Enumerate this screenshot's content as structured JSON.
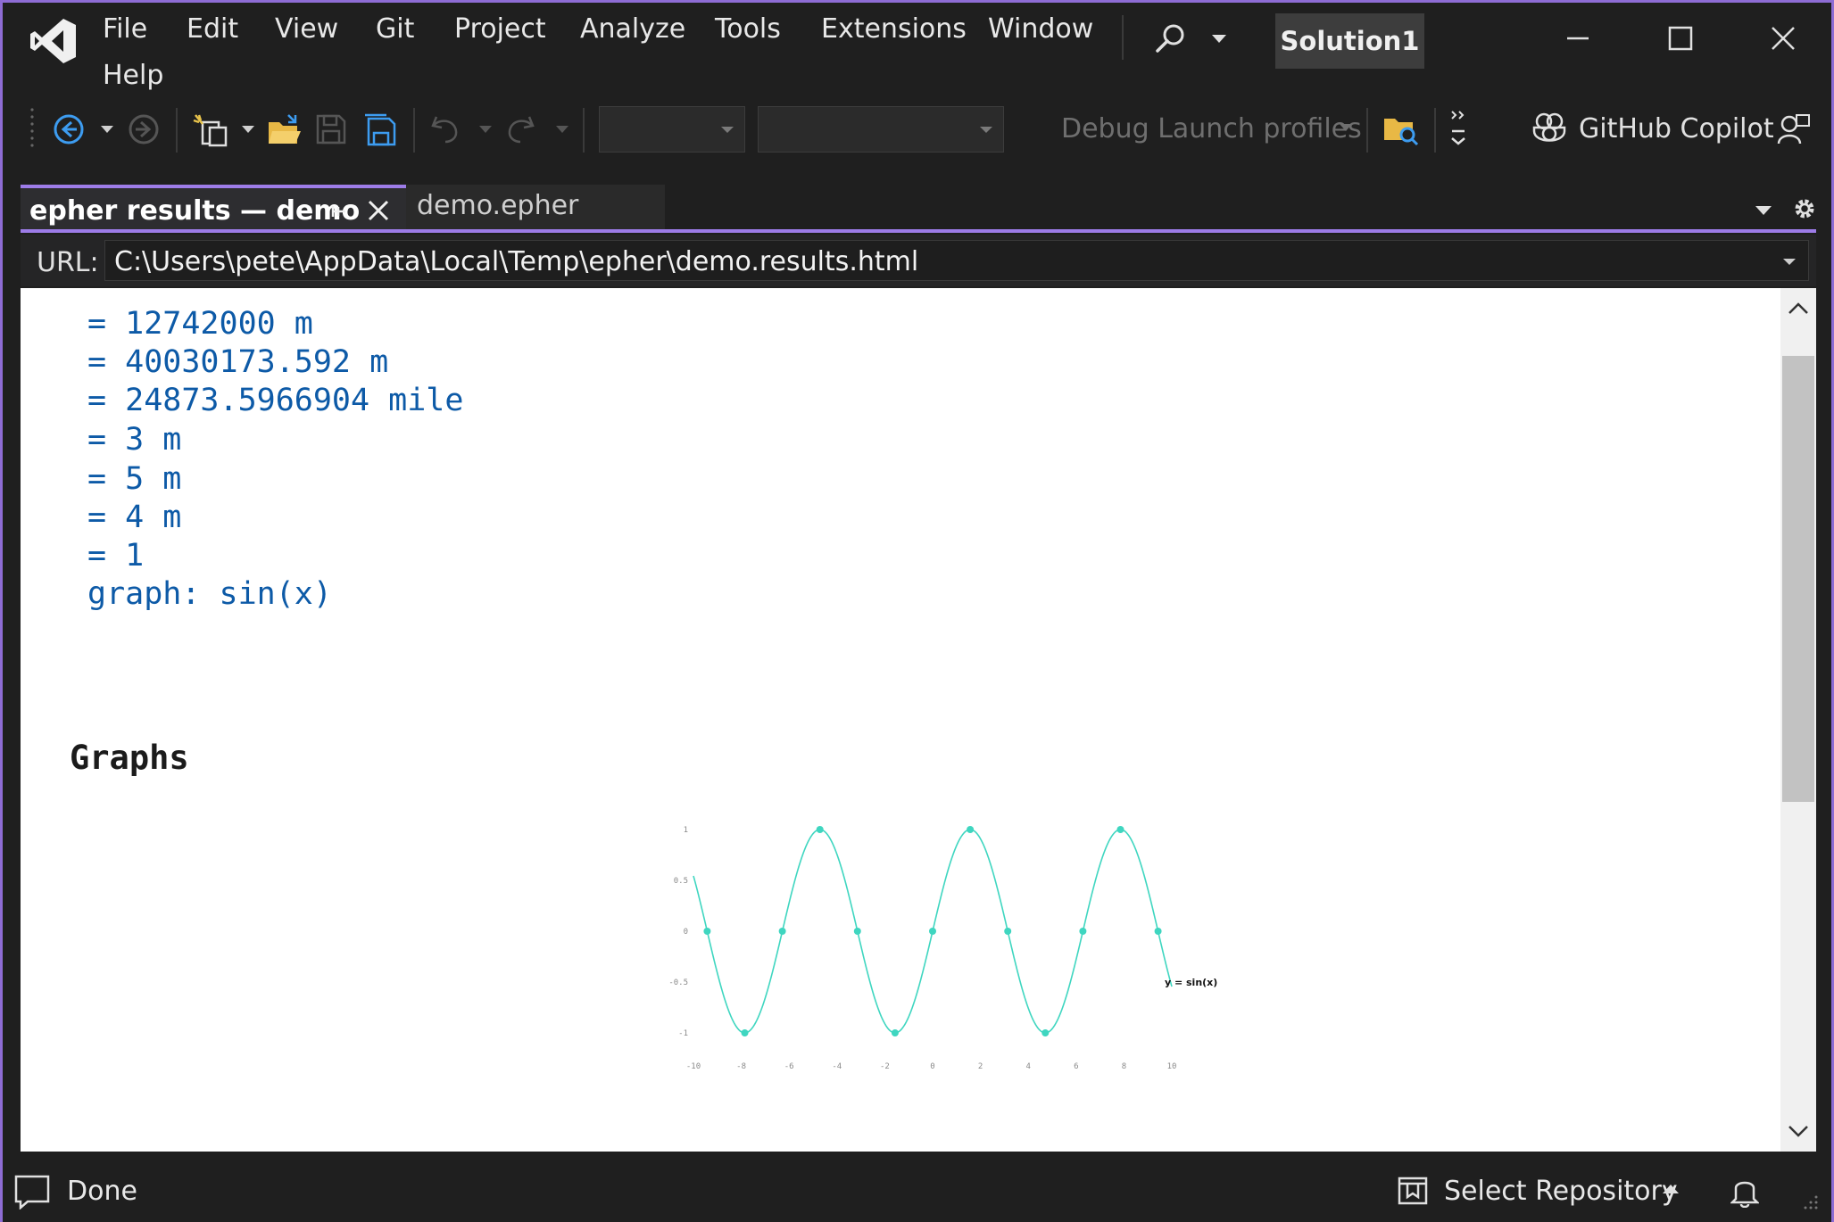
{
  "menu": [
    "File",
    "Edit",
    "View",
    "Git",
    "Project",
    "Analyze",
    "Tools",
    "Extensions",
    "Window",
    "Help"
  ],
  "solution_name": "Solution1",
  "toolbar": {
    "debug_launch_label": "Debug Launch profiles",
    "copilot_label": "GitHub Copilot"
  },
  "tabs": {
    "active": "epher results — demo",
    "inactive": "demo.epher"
  },
  "url": {
    "label": "URL:",
    "value": "C:\\Users\\pete\\AppData\\Local\\Temp\\epher\\demo.results.html"
  },
  "results": [
    "= 12742000 m",
    "= 40030173.592 m",
    "= 24873.5966904 mile",
    "= 3 m",
    "= 5 m",
    "= 4 m",
    "= 1",
    "graph: sin(x)"
  ],
  "graphs_heading": "Graphs",
  "chart_data": {
    "type": "line",
    "function": "sin(x)",
    "legend": "y = sin(x)",
    "xlim": [
      -10,
      10
    ],
    "ylim": [
      -1,
      1
    ],
    "x_ticks": [
      "-10",
      "-8",
      "-6",
      "-4",
      "-2",
      "0",
      "2",
      "4",
      "6",
      "8",
      "10"
    ],
    "y_ticks": [
      "1",
      "0.5",
      "0",
      "-0.5",
      "-1"
    ],
    "marked_points": [
      {
        "x": -9.425,
        "y": 0
      },
      {
        "x": -7.854,
        "y": -1
      },
      {
        "x": -6.283,
        "y": 0
      },
      {
        "x": -4.712,
        "y": 1
      },
      {
        "x": -3.142,
        "y": 0
      },
      {
        "x": -1.571,
        "y": -1
      },
      {
        "x": 0,
        "y": 0
      },
      {
        "x": 1.571,
        "y": 1
      },
      {
        "x": 3.142,
        "y": 0
      },
      {
        "x": 4.712,
        "y": -1
      },
      {
        "x": 6.283,
        "y": 0
      },
      {
        "x": 7.854,
        "y": 1
      },
      {
        "x": 9.425,
        "y": 0
      }
    ],
    "color": "#3fd6c0"
  },
  "status": {
    "text": "Done",
    "repo_label": "Select Repository"
  },
  "colors": {
    "accent": "#8e6cd4",
    "result_text": "#0d5aa7"
  }
}
